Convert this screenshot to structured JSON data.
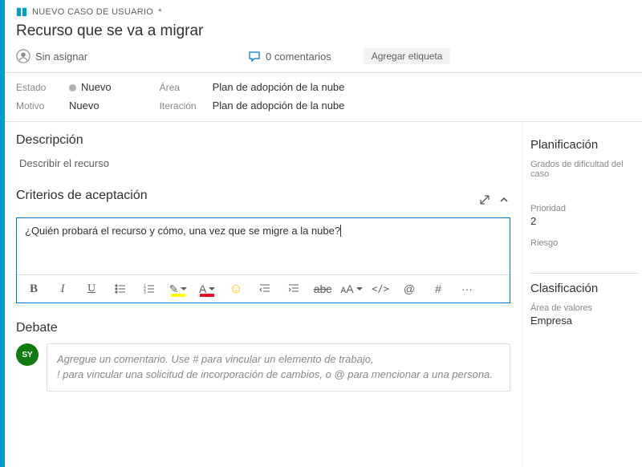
{
  "header": {
    "workItemType": "NUEVO CASO DE USUARIO",
    "dirtyMark": "*",
    "title": "Recurso que se va a migrar",
    "assignee": "Sin asignar",
    "commentsCount": "0 comentarios",
    "addTag": "Agregar etiqueta"
  },
  "fields": {
    "stateLabel": "Estado",
    "stateValue": "Nuevo",
    "reasonLabel": "Motivo",
    "reasonValue": "Nuevo",
    "areaLabel": "Área",
    "areaValue": "Plan de adopción de la nube",
    "iterationLabel": "Iteración",
    "iterationValue": "Plan de adopción de la nube"
  },
  "sections": {
    "description": {
      "title": "Descripción",
      "placeholder": "Describir el recurso"
    },
    "acceptance": {
      "title": "Criterios de aceptación",
      "content": "¿Quién probará el recurso y cómo, una vez que se migre a la nube?"
    },
    "debate": {
      "title": "Debate",
      "avatarInitials": "SY",
      "placeholderLine1": "Agregue un comentario. Use # para vincular un elemento de trabajo,",
      "placeholderLine2": "! para vincular una solicitud de incorporación de cambios, o @ para mencionar a una persona."
    }
  },
  "sidebar": {
    "planningTitle": "Planificación",
    "storyPointsLabel": "Grados de dificultad del caso",
    "priorityLabel": "Prioridad",
    "priorityValue": "2",
    "riskLabel": "Riesgo",
    "classificationTitle": "Clasificación",
    "valueAreaLabel": "Área de valores",
    "valueAreaValue": "Empresa"
  },
  "toolbar": {
    "bold": "B",
    "italic": "I",
    "underline": "U",
    "fontColorLetter": "A",
    "highlightGlyph": "✎",
    "fontSizeGlyph": "ᴀA",
    "mention": "@",
    "hash": "#",
    "more": "···",
    "code": "</>",
    "strike": "abc"
  }
}
